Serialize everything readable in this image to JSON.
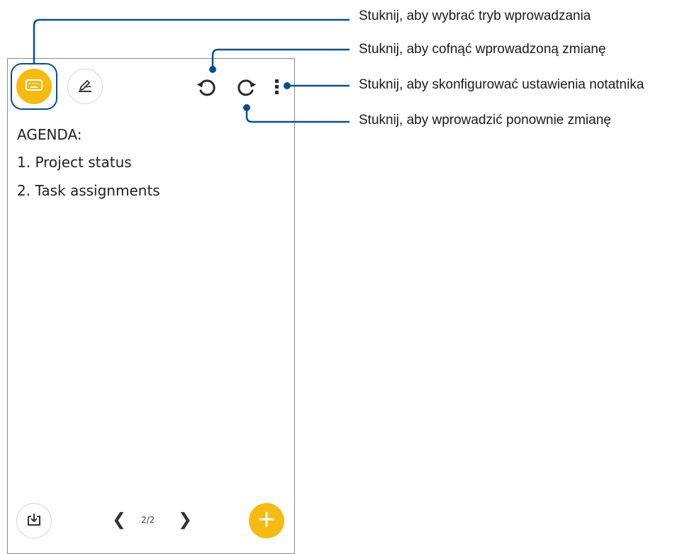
{
  "toolbar": {
    "input_mode_icon": "keyboard-icon",
    "handwriting_icon": "handwriting-pen-icon",
    "undo_icon": "undo-icon",
    "redo_icon": "redo-icon",
    "more_icon": "more-vertical-icon"
  },
  "note": {
    "lines": [
      "AGENDA:",
      "1. Project status",
      "2. Task assignments"
    ]
  },
  "bottom_bar": {
    "import_icon": "import-icon",
    "prev_label": "❮",
    "page_indicator": "2/2",
    "next_label": "❯",
    "add_icon": "plus-icon"
  },
  "callouts": {
    "input_mode": "Stuknij, aby wybrać tryb wprowadzania",
    "undo": "Stuknij, aby cofnąć wprowadzoną zmianę",
    "settings": "Stuknij, aby skonfigurować ustawienia notatnika",
    "redo": "Stuknij, aby wprowadzić ponownie zmianę"
  },
  "colors": {
    "accent": "#f5bb12",
    "callout_line": "#0b4f8a",
    "frame": "#8a8a8a"
  }
}
